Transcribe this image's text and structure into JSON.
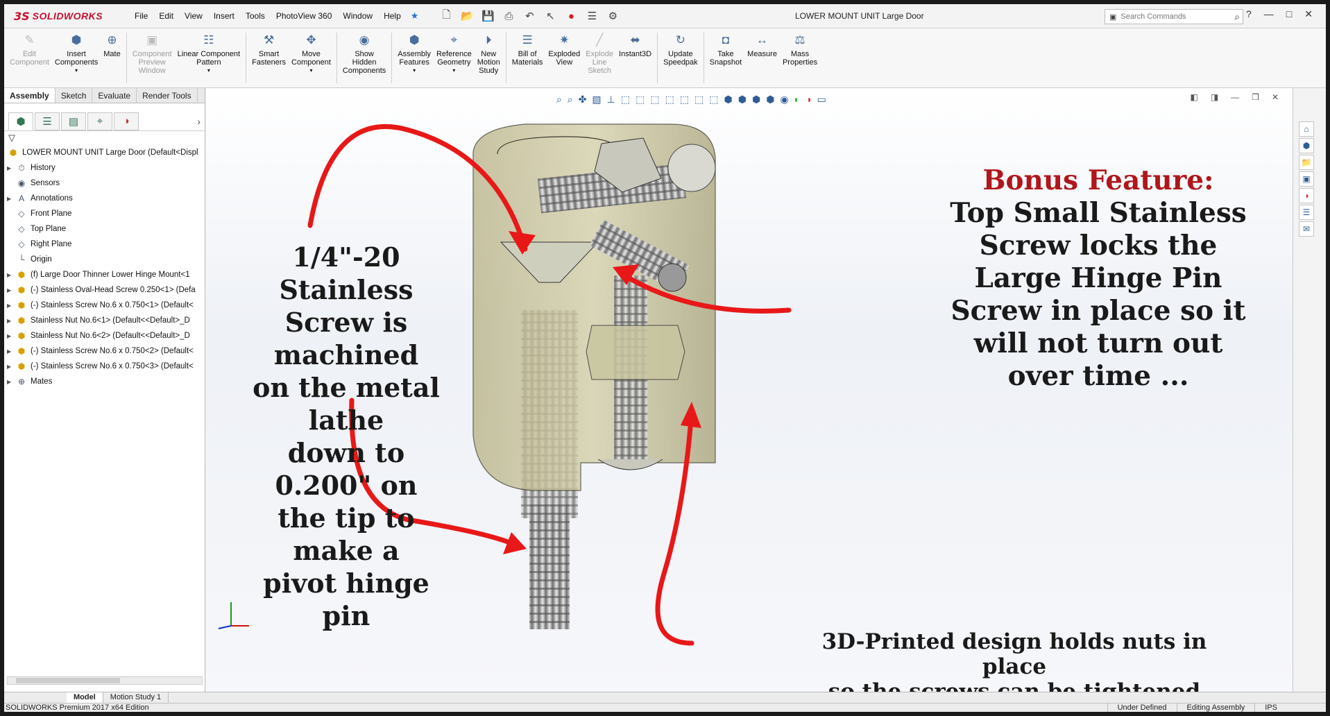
{
  "app": {
    "logo_ds": "3S",
    "logo_name": "SOLIDWORKS",
    "document_title": "LOWER MOUNT UNIT Large Door",
    "search_placeholder": "Search Commands"
  },
  "menu": [
    "File",
    "Edit",
    "View",
    "Insert",
    "Tools",
    "PhotoView 360",
    "Window",
    "Help"
  ],
  "commands": [
    {
      "label": "Edit\nComponent",
      "icon": "edit-component-icon",
      "enabled": false
    },
    {
      "label": "Insert\nComponents",
      "icon": "insert-components-icon",
      "enabled": true,
      "dropdown": true
    },
    {
      "label": "Mate",
      "icon": "mate-icon",
      "enabled": true
    },
    {
      "label": "Component\nPreview\nWindow",
      "icon": "component-preview-icon",
      "enabled": false
    },
    {
      "label": "Linear Component\nPattern",
      "icon": "linear-pattern-icon",
      "enabled": true,
      "dropdown": true
    },
    {
      "label": "Smart\nFasteners",
      "icon": "smart-fasteners-icon",
      "enabled": true
    },
    {
      "label": "Move\nComponent",
      "icon": "move-component-icon",
      "enabled": true,
      "dropdown": true
    },
    {
      "label": "Show\nHidden\nComponents",
      "icon": "show-hidden-icon",
      "enabled": true
    },
    {
      "label": "Assembly\nFeatures",
      "icon": "assembly-features-icon",
      "enabled": true,
      "dropdown": true
    },
    {
      "label": "Reference\nGeometry",
      "icon": "reference-geometry-icon",
      "enabled": true,
      "dropdown": true
    },
    {
      "label": "New\nMotion\nStudy",
      "icon": "motion-study-icon",
      "enabled": true
    },
    {
      "label": "Bill of\nMaterials",
      "icon": "bill-of-materials-icon",
      "enabled": true
    },
    {
      "label": "Exploded\nView",
      "icon": "exploded-view-icon",
      "enabled": true
    },
    {
      "label": "Explode\nLine\nSketch",
      "icon": "explode-line-icon",
      "enabled": false
    },
    {
      "label": "Instant3D",
      "icon": "instant3d-icon",
      "enabled": true
    },
    {
      "label": "Update\nSpeedpak",
      "icon": "speedpak-icon",
      "enabled": true
    },
    {
      "label": "Take\nSnapshot",
      "icon": "camera-icon",
      "enabled": true
    },
    {
      "label": "Measure",
      "icon": "measure-icon",
      "enabled": true
    },
    {
      "label": "Mass\nProperties",
      "icon": "mass-properties-icon",
      "enabled": true
    }
  ],
  "cm_tabs": [
    "Assembly",
    "Sketch",
    "Evaluate",
    "Render Tools"
  ],
  "tree": {
    "root": "LOWER MOUNT UNIT Large Door  (Default<Displ",
    "items": [
      {
        "label": "History",
        "icon": "history-icon",
        "expand": true
      },
      {
        "label": "Sensors",
        "icon": "sensor-icon",
        "expand": false
      },
      {
        "label": "Annotations",
        "icon": "annotation-icon",
        "expand": true
      },
      {
        "label": "Front Plane",
        "icon": "plane-icon",
        "expand": false
      },
      {
        "label": "Top Plane",
        "icon": "plane-icon",
        "expand": false
      },
      {
        "label": "Right Plane",
        "icon": "plane-icon",
        "expand": false
      },
      {
        "label": "Origin",
        "icon": "origin-icon",
        "expand": false
      },
      {
        "label": "(f) Large Door Thinner Lower Hinge Mount<1",
        "icon": "part-icon",
        "expand": true
      },
      {
        "label": "(-) Stainless Oval-Head Screw 0.250<1> (Defa",
        "icon": "part-icon",
        "expand": true
      },
      {
        "label": "(-) Stainless Screw No.6 x 0.750<1> (Default<",
        "icon": "part-icon",
        "expand": true
      },
      {
        "label": "Stainless Nut No.6<1> (Default<<Default>_D",
        "icon": "part-icon",
        "expand": true
      },
      {
        "label": "Stainless Nut No.6<2> (Default<<Default>_D",
        "icon": "part-icon",
        "expand": true
      },
      {
        "label": "(-) Stainless Screw No.6 x 0.750<2> (Default<",
        "icon": "part-icon",
        "expand": true
      },
      {
        "label": "(-) Stainless Screw No.6 x 0.750<3> (Default<",
        "icon": "part-icon",
        "expand": true
      },
      {
        "label": "Mates",
        "icon": "mates-icon",
        "expand": true
      }
    ]
  },
  "callouts": {
    "main_lines": [
      "1/4\"-20 Stainless",
      "Screw is machined",
      "on the metal lathe",
      "down to 0.200\" on",
      "the tip to make a",
      "pivot hinge pin"
    ],
    "bonus_title": "Bonus Feature:",
    "bonus_lines": [
      "Top Small Stainless",
      "Screw locks the",
      "Large Hinge Pin",
      "Screw in place so it",
      "will not turn out",
      "over time ..."
    ],
    "bottom_lines": [
      "3D-Printed design holds nuts in place",
      "so the screws can be tightened"
    ]
  },
  "colors": {
    "arrow": "#e81818",
    "bonus": "#b0161b",
    "brand": "#c8102e"
  },
  "bottom_tabs": [
    "Model",
    "Motion Study 1"
  ],
  "status": {
    "edition": "SOLIDWORKS Premium 2017 x64 Edition",
    "state": "Under Defined",
    "mode": "Editing Assembly",
    "units": "IPS"
  }
}
